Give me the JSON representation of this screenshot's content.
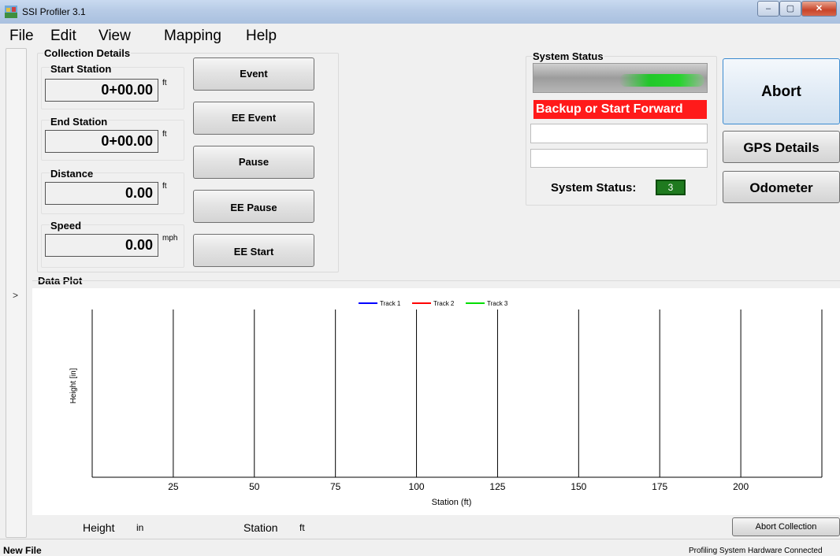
{
  "window": {
    "title": "SSI Profiler 3.1",
    "minimize": "–",
    "maximize": "▢",
    "close": "✕"
  },
  "menu": [
    "File",
    "Edit",
    "View",
    "Mapping",
    "Help"
  ],
  "collapse_arrow": ">",
  "collection": {
    "title": "Collection Details",
    "start_station": {
      "label": "Start Station",
      "value": "0+00.00",
      "unit": "ft"
    },
    "end_station": {
      "label": "End Station",
      "value": "0+00.00",
      "unit": "ft"
    },
    "distance": {
      "label": "Distance",
      "value": "0.00",
      "unit": "ft"
    },
    "speed": {
      "label": "Speed",
      "value": "0.00",
      "unit": "mph"
    }
  },
  "event_buttons": [
    "Event",
    "EE Event",
    "Pause",
    "EE Pause",
    "EE Start"
  ],
  "system_status": {
    "title": "System Status",
    "message": "Backup or Start Forward",
    "field1": "",
    "field2": "",
    "count_label": "System Status:",
    "count_value": "3"
  },
  "right_buttons": {
    "abort": "Abort",
    "gps": "GPS Details",
    "odometer": "Odometer"
  },
  "data_plot": {
    "title": "Data Plot"
  },
  "chart_data": {
    "type": "line",
    "title": "",
    "xlabel": "Station (ft)",
    "ylabel": "Height [in]",
    "xlim": [
      0,
      225
    ],
    "x_ticks": [
      25,
      50,
      75,
      100,
      125,
      150,
      175,
      200
    ],
    "grid": "vertical",
    "legend": "top-center",
    "series": [
      {
        "name": "Track 1",
        "color": "#0000ff",
        "values": []
      },
      {
        "name": "Track 2",
        "color": "#ff0000",
        "values": []
      },
      {
        "name": "Track 3",
        "color": "#00dd00",
        "values": []
      }
    ]
  },
  "readout": {
    "height_label": "Height",
    "height_unit": "in",
    "station_label": "Station",
    "station_unit": "ft"
  },
  "abort_collection": "Abort Collection",
  "status_strip": {
    "left": "New File",
    "right": "Profiling System Hardware Connected"
  }
}
